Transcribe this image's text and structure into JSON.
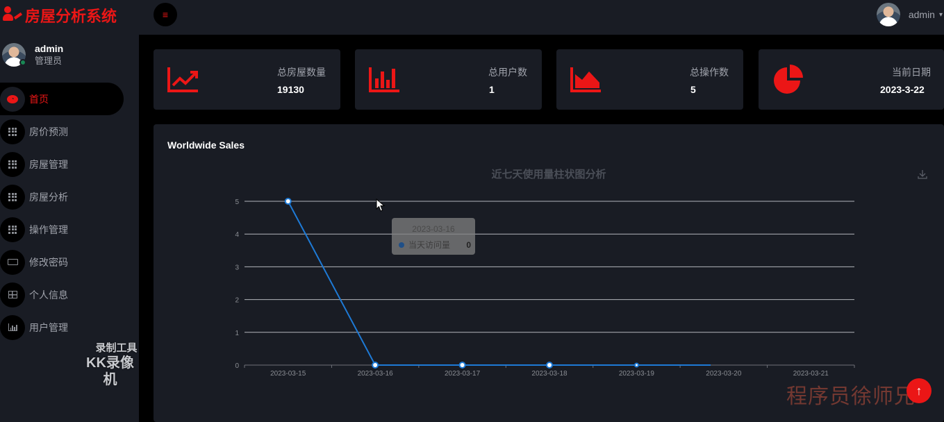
{
  "app": {
    "title": "房屋分析系统"
  },
  "topbar": {
    "user_name": "admin"
  },
  "sidebar": {
    "user": {
      "name": "admin",
      "role": "管理员"
    },
    "items": [
      {
        "label": "首页",
        "icon": "dashboard-icon",
        "active": true
      },
      {
        "label": "房价预测",
        "icon": "grid-icon"
      },
      {
        "label": "房屋管理",
        "icon": "grid-icon"
      },
      {
        "label": "房屋分析",
        "icon": "grid-icon"
      },
      {
        "label": "操作管理",
        "icon": "grid-icon"
      },
      {
        "label": "修改密码",
        "icon": "keyboard-icon"
      },
      {
        "label": "个人信息",
        "icon": "table-icon"
      },
      {
        "label": "用户管理",
        "icon": "bar-chart-icon"
      }
    ]
  },
  "stats": [
    {
      "label": "总房屋数量",
      "value": "19130",
      "icon": "line-chart-icon"
    },
    {
      "label": "总用户数",
      "value": "1",
      "icon": "bar-chart-icon"
    },
    {
      "label": "总操作数",
      "value": "5",
      "icon": "area-chart-icon"
    },
    {
      "label": "当前日期",
      "value": "2023-3-22",
      "icon": "pie-chart-icon"
    }
  ],
  "panel": {
    "title": "Worldwide Sales"
  },
  "chart_data": {
    "type": "line",
    "title": "近七天使用量柱状图分析",
    "xlabel": "",
    "ylabel": "",
    "categories": [
      "2023-03-15",
      "2023-03-16",
      "2023-03-17",
      "2023-03-18",
      "2023-03-19",
      "2023-03-20",
      "2023-03-21"
    ],
    "series": [
      {
        "name": "当天访问量",
        "values": [
          5,
          0,
          0,
          0,
          0,
          null,
          null
        ]
      }
    ],
    "ylim": [
      0,
      5
    ],
    "yticks": [
      "0",
      "1",
      "2",
      "3",
      "4",
      "5"
    ],
    "grid": true,
    "color": "#1e7ad6"
  },
  "tooltip": {
    "date": "2023-03-16",
    "series_name": "当天访问量",
    "value": "0"
  },
  "watermarks": {
    "left_top": "录制工具",
    "left_bottom": "KK录像机",
    "right": "程序员徐师兄"
  },
  "colors": {
    "accent": "#eb1616",
    "panel": "#191c24",
    "background": "#000000"
  }
}
